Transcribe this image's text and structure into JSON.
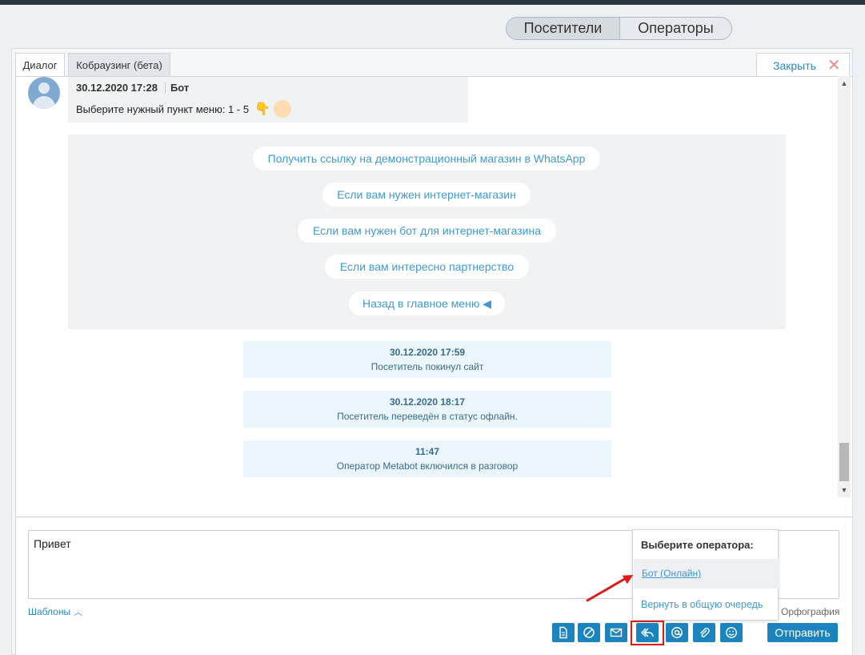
{
  "header": {
    "toggle": [
      "Посетители",
      "Операторы"
    ]
  },
  "tabs": {
    "dialog": "Диалог",
    "cobrowse": "Кобраузинг (бета)",
    "close": "Закрыть"
  },
  "chat": {
    "bot_message": {
      "date": "30.12.2020 17:28",
      "author": "Бот",
      "text": "Выберите нужный пункт меню: 1 - 5",
      "emoji": "👇"
    },
    "quick_buttons": [
      "Получить ссылку на демонстрационный магазин в WhatsApp",
      "Если вам нужен интернет-магазин",
      "Если вам нужен бот для интернет-магазина",
      "Если вам интересно партнерство",
      "Назад в главное меню ◀"
    ],
    "system_messages": [
      {
        "time": "30.12.2020 17:59",
        "text": "Посетитель покинул сайт"
      },
      {
        "time": "30.12.2020 18:17",
        "text": "Посетитель переведён в статус офлайн."
      },
      {
        "time": "11:47",
        "text": "Оператор Metabot включился в разговор"
      }
    ]
  },
  "composer": {
    "text": "Привет",
    "templates_label": "Шаблоны",
    "spelling_label": "Орфография",
    "send_label": "Отправить"
  },
  "operator_popup": {
    "title": "Выберите оператора:",
    "items": [
      "Бот (Онлайн)",
      "Вернуть в общую очередь"
    ]
  },
  "colors": {
    "accent": "#1b84bf",
    "link": "#3e9ad2",
    "highlight": "#e01919"
  }
}
